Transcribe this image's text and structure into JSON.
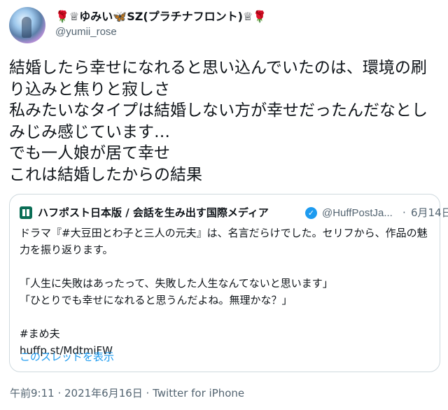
{
  "author": {
    "display_name_prefix": "🌹♕ゆみい",
    "display_name_butterfly": "🦋",
    "display_name_core": "SZ(プラチナフロント)",
    "display_name_suffix": "♕🌹",
    "handle": "@yumii_rose"
  },
  "more_label": "···",
  "tweet": {
    "text": "結婚したら幸せになれると思い込んでいたのは、環境の刷り込みと焦りと寂しさ\n私みたいなタイプは結婚しない方が幸せだったんだなとしみじみ感じています…\nでも一人娘が居て幸せ\nこれは結婚したからの結果"
  },
  "quote": {
    "name": "ハフポスト日本版 / 会話を生み出す国際メディア",
    "verified_icon": "verified-badge-icon",
    "handle": "@HuffPostJa...",
    "dot": "·",
    "date": "6月14日",
    "body": "ドラマ『#大豆田とわ子と三人の元夫』は、名言だらけでした。セリフから、作品の魅力を振り返ります。\n\n「人生に失敗はあったって、失敗した人生なんてないと思います」\n「ひとりでも幸せになれると思うんだよね。無理かな？」\n\n#まめ夫\nhuffp.st/MdtmiFW",
    "thread_link": "このスレッドを表示"
  },
  "meta": {
    "time_date": "午前9:11 · 2021年6月16日 · Twitter for iPhone"
  },
  "colors": {
    "text": "#0f1419",
    "secondary": "#536471",
    "link": "#1d9bf0",
    "border": "#cfd9de"
  }
}
